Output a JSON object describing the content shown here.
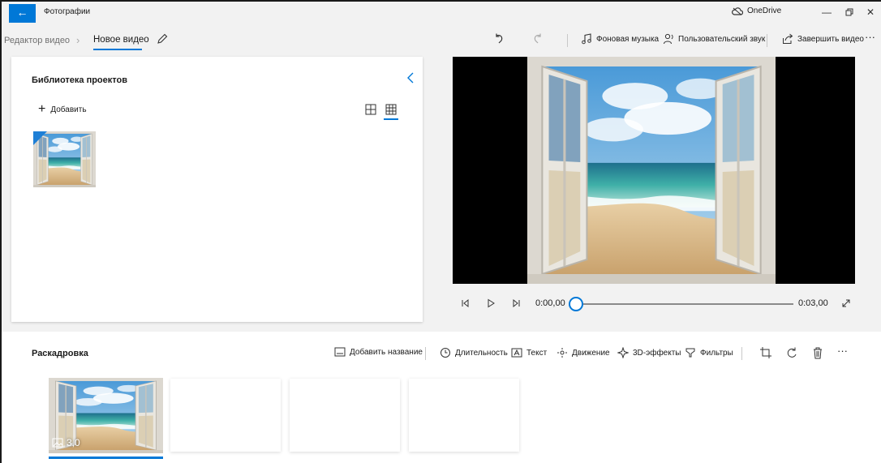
{
  "titlebar": {
    "app_title": "Фотографии",
    "onedrive_label": "OneDrive",
    "icons": [
      "back-arrow-icon",
      "onedrive-cloud-icon",
      "minimize-icon",
      "restore-icon",
      "close-icon"
    ]
  },
  "breadcrumb": {
    "parent": "Редактор видео",
    "current": "Новое видео"
  },
  "toolbar": {
    "background_music": "Фоновая музыка",
    "custom_audio": "Пользовательский звук",
    "finish_video": "Завершить видео"
  },
  "library": {
    "title": "Библиотека проектов",
    "add_label": "Добавить"
  },
  "player": {
    "current_time": "0:00,00",
    "total_time": "0:03,00",
    "progress": 0
  },
  "storyboard": {
    "title": "Раскадровка",
    "add_title": "Добавить название",
    "duration": "Длительность",
    "text": "Текст",
    "motion": "Движение",
    "effects_3d": "3D-эффекты",
    "filters": "Фильтры",
    "clip_duration": "3,0"
  },
  "colors": {
    "accent": "#0078d7",
    "window_bg": "#f2f2f2",
    "panel_bg": "#ffffff",
    "preview_bg": "#000000"
  }
}
